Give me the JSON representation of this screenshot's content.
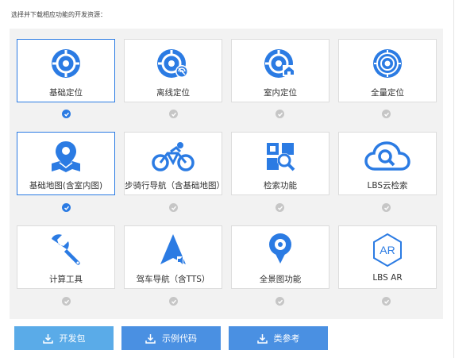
{
  "header": {
    "text": "选择并下载相应功能的开发资源："
  },
  "colors": {
    "accent": "#2b7be3",
    "button": "#4a90e2",
    "button_active": "#5aabe8",
    "check_off": "#c6c6c6"
  },
  "cards": [
    {
      "label": "基础定位",
      "icon": "location-target-icon",
      "selected": true
    },
    {
      "label": "离线定位",
      "icon": "offline-location-icon",
      "selected": false
    },
    {
      "label": "室内定位",
      "icon": "indoor-location-icon",
      "selected": false
    },
    {
      "label": "全量定位",
      "icon": "full-location-icon",
      "selected": false
    },
    {
      "label": "基础地图(含室内图)",
      "icon": "map-pin-icon",
      "selected": true
    },
    {
      "label": "步骑行导航（含基础地图）",
      "icon": "bicycle-icon",
      "selected": false
    },
    {
      "label": "检索功能",
      "icon": "search-grid-icon",
      "selected": false
    },
    {
      "label": "LBS云检索",
      "icon": "cloud-search-icon",
      "selected": false
    },
    {
      "label": "计算工具",
      "icon": "wrench-icon",
      "selected": false
    },
    {
      "label": "驾车导航（含TTS）",
      "icon": "drive-navigation-icon",
      "selected": false
    },
    {
      "label": "全景图功能",
      "icon": "panorama-icon",
      "selected": false
    },
    {
      "label": "LBS AR",
      "icon": "ar-icon",
      "selected": false
    }
  ],
  "buttons": [
    {
      "label": "开发包",
      "icon": "download-icon"
    },
    {
      "label": "示例代码",
      "icon": "download-icon"
    },
    {
      "label": "类参考",
      "icon": "download-icon"
    }
  ]
}
